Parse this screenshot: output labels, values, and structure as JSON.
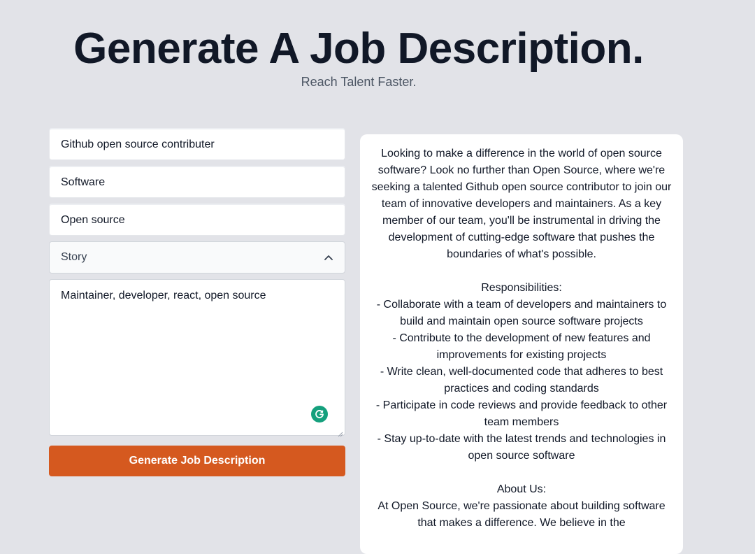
{
  "header": {
    "title": "Generate A Job Description.",
    "subtitle": "Reach Talent Faster."
  },
  "form": {
    "job_title": "Github open source contributer",
    "industry": "Software",
    "company": "Open source",
    "tone": {
      "selected": "Story"
    },
    "keywords": "Maintainer, developer, react, open source",
    "submit_label": "Generate Job Description"
  },
  "output": {
    "intro": "Looking to make a difference in the world of open source software? Look no further than Open Source, where we're seeking a talented Github open source contributor to join our team of innovative developers and maintainers. As a key member of our team, you'll be instrumental in driving the development of cutting-edge software that pushes the boundaries of what's possible.",
    "responsibilities_heading": "Responsibilities:",
    "responsibilities": [
      "- Collaborate with a team of developers and maintainers to build and maintain open source software projects",
      "- Contribute to the development of new features and improvements for existing projects",
      "- Write clean, well-documented code that adheres to best practices and coding standards",
      "- Participate in code reviews and provide feedback to other team members",
      "- Stay up-to-date with the latest trends and technologies in open source software"
    ],
    "about_heading": "About Us:",
    "about": "At Open Source, we're passionate about building software that makes a difference. We believe in the"
  },
  "colors": {
    "background": "#e2e3e8",
    "accent_button": "#d5591f",
    "grammarly": "#15a07d"
  },
  "icons": {
    "select_chevron": "chevron-up-icon",
    "textarea_badge": "grammarly-icon"
  }
}
